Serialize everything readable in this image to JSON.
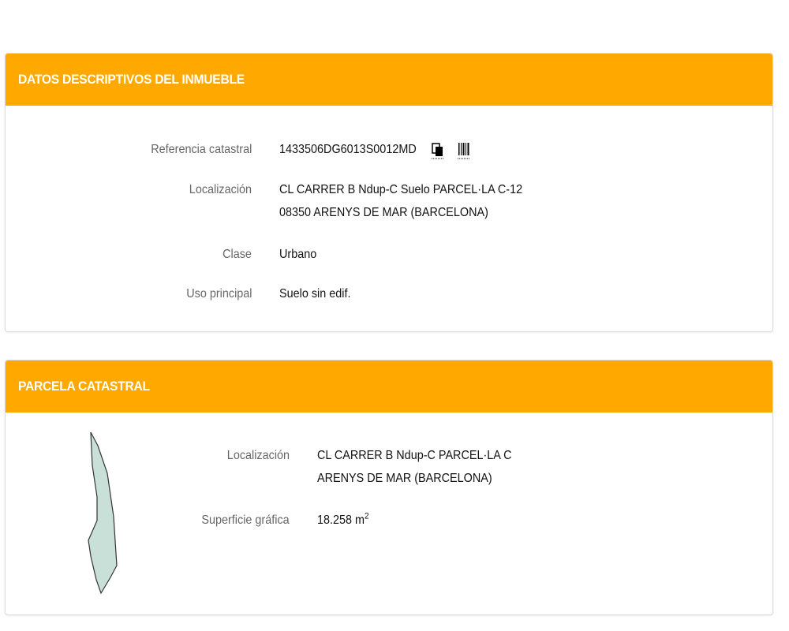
{
  "descriptive": {
    "title": "DATOS DESCRIPTIVOS DEL INMUEBLE",
    "referencia_label": "Referencia catastral",
    "referencia_value": "1433506DG6013S0012MD",
    "localizacion_label": "Localización",
    "localizacion_line1": "CL CARRER B Ndup-C Suelo PARCEL·LA C-12",
    "localizacion_line2": "08350 ARENYS DE MAR (BARCELONA)",
    "clase_label": "Clase",
    "clase_value": "Urbano",
    "uso_label": "Uso principal",
    "uso_value": "Suelo sin edif."
  },
  "parcela": {
    "title": "PARCELA CATASTRAL",
    "localizacion_label": "Localización",
    "localizacion_line1": "CL CARRER B Ndup-C PARCEL·LA C",
    "localizacion_line2": "ARENYS DE MAR (BARCELONA)",
    "superficie_label": "Superficie gráfica",
    "superficie_value": "18.258 m",
    "superficie_unit_sup": "2"
  },
  "colors": {
    "header": "#ffa800",
    "parcel_fill": "#c9e0d8",
    "parcel_stroke": "#333333"
  },
  "icons": {
    "copy": "copy-icon",
    "barcode": "barcode-icon"
  }
}
